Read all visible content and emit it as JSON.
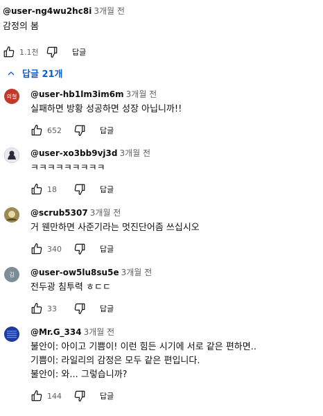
{
  "top_comment": {
    "author": "@user-ng4wu2hc8i",
    "time": "3개월 전",
    "text": "감정의 봄",
    "likes": "1.1천",
    "reply_label": "답글"
  },
  "replies_toggle": {
    "label": "답글 21개"
  },
  "replies": [
    {
      "author": "@user-hb1lm3im6m",
      "time": "3개월 전",
      "avatar_text": "의철",
      "avatar_color": "#c0392b",
      "lines": [
        "실패하면 방황 성공하면 성장 아닙니까!!"
      ],
      "likes": "652",
      "reply_label": "답글"
    },
    {
      "author": "@user-xo3bb9vj3d",
      "time": "3개월 전",
      "avatar_text": "",
      "avatar_color": "#2b2b3a",
      "lines": [
        "ㅋㅋㅋㅋㅋㅋㅋㅋㅋ"
      ],
      "likes": "18",
      "reply_label": "답글"
    },
    {
      "author": "@scrub5307",
      "time": "3개월 전",
      "avatar_text": "",
      "avatar_color": "#7a6a3a",
      "lines": [
        "거 웬만하면 사준기라는 멋진단어좀 쓰십시오"
      ],
      "likes": "340",
      "reply_label": "답글"
    },
    {
      "author": "@user-ow5lu8su5e",
      "time": "3개월 전",
      "avatar_text": "김",
      "avatar_color": "#7d8d96",
      "lines": [
        "전두광 침투력 ㅎㄷㄷ"
      ],
      "likes": "33",
      "reply_label": "답글"
    },
    {
      "author": "@Mr.G_334",
      "time": "3개월 전",
      "avatar_text": "",
      "avatar_color": "#1d3d9c",
      "lines": [
        "불안이: 아이고 기쁨이! 이런 힘든 시기에 서로 같은 편하면..",
        "기쁨이: 라일리의 감정은 모두 같은 편입니다.",
        "불안이: 와... 그렇습니까?"
      ],
      "likes": "144",
      "reply_label": "답글"
    }
  ]
}
